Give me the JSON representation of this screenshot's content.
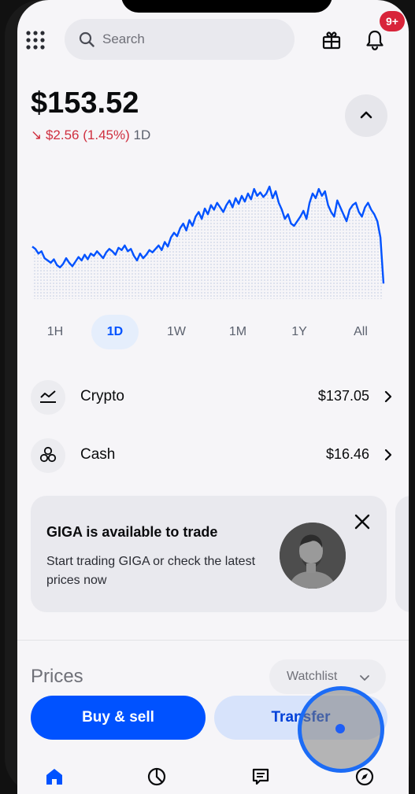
{
  "header": {
    "search_placeholder": "Search",
    "notification_badge": "9+"
  },
  "portfolio": {
    "balance": "$153.52",
    "change_amount": "↘ $2.56 (1.45%)",
    "change_period": "1D"
  },
  "chart_data": {
    "type": "line",
    "series": [
      {
        "values": [
          62,
          60,
          56,
          58,
          52,
          50,
          48,
          51,
          46,
          44,
          47,
          52,
          48,
          45,
          49,
          53,
          50,
          55,
          51,
          56,
          54,
          58,
          55,
          52,
          57,
          60,
          58,
          55,
          61,
          59,
          63,
          58,
          60,
          54,
          50,
          56,
          52,
          55,
          59,
          57,
          60,
          63,
          59,
          66,
          62,
          70,
          74,
          71,
          78,
          82,
          76,
          85,
          80,
          88,
          92,
          86,
          95,
          90,
          98,
          94,
          100,
          96,
          92,
          98,
          102,
          96,
          104,
          99,
          106,
          101,
          108,
          103,
          112,
          106,
          109,
          105,
          108,
          114,
          104,
          110,
          100,
          94,
          86,
          90,
          82,
          80,
          84,
          88,
          93,
          86,
          100,
          108,
          104,
          112,
          106,
          110,
          98,
          92,
          88,
          102,
          96,
          90,
          84,
          94,
          98,
          100,
          92,
          88,
          96,
          100,
          94,
          90,
          84,
          70,
          30
        ]
      }
    ],
    "ylim": [
      20,
      125
    ],
    "color": "#0052ff",
    "fill": "dotted"
  },
  "ranges": [
    {
      "label": "1H",
      "active": false
    },
    {
      "label": "1D",
      "active": true
    },
    {
      "label": "1W",
      "active": false
    },
    {
      "label": "1M",
      "active": false
    },
    {
      "label": "1Y",
      "active": false
    },
    {
      "label": "All",
      "active": false
    }
  ],
  "assets": [
    {
      "label": "Crypto",
      "value": "$137.05",
      "icon": "trend-chart-icon"
    },
    {
      "label": "Cash",
      "value": "$16.46",
      "icon": "coins-icon"
    }
  ],
  "promo": {
    "title": "GIGA is available to trade",
    "body": "Start trading GIGA or check the latest prices now"
  },
  "prices": {
    "title": "Prices",
    "filter_label": "Watchlist"
  },
  "actions": {
    "buy_sell_label": "Buy & sell",
    "transfer_label": "Transfer"
  },
  "tabbar": [
    "home-icon",
    "portfolio-pie-icon",
    "news-icon",
    "explore-compass-icon"
  ],
  "colors": {
    "accent": "#0052ff",
    "negative": "#cf2f3f",
    "badge": "#d8243a"
  }
}
